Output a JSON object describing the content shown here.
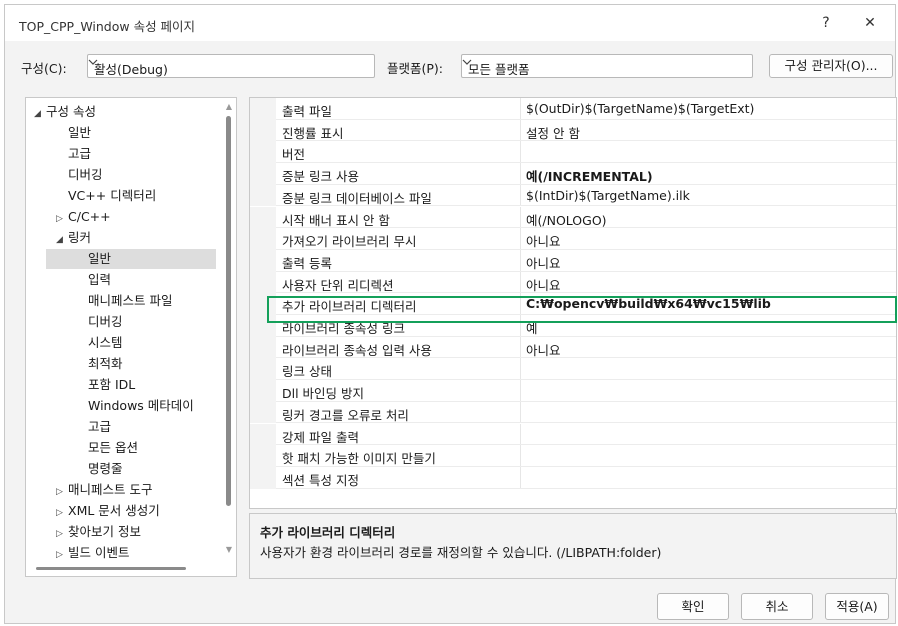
{
  "window": {
    "title": "TOP_CPP_Window 속성 페이지",
    "help": "?",
    "close": "✕"
  },
  "config": {
    "config_label": "구성(C):",
    "config_value": "활성(Debug)",
    "platform_label": "플랫폼(P):",
    "platform_value": "모든 플랫폼",
    "manager_button": "구성 관리자(O)..."
  },
  "tree": [
    {
      "label": "구성 속성",
      "arrow": "◢",
      "level": 0
    },
    {
      "label": "일반",
      "arrow": "",
      "level": 1
    },
    {
      "label": "고급",
      "arrow": "",
      "level": 1
    },
    {
      "label": "디버깅",
      "arrow": "",
      "level": 1
    },
    {
      "label": "VC++ 디렉터리",
      "arrow": "",
      "level": 1
    },
    {
      "label": "C/C++",
      "arrow": "▷",
      "level": 1
    },
    {
      "label": "링커",
      "arrow": "◢",
      "level": 1
    },
    {
      "label": "일반",
      "arrow": "",
      "level": 2,
      "selected": true
    },
    {
      "label": "입력",
      "arrow": "",
      "level": 2
    },
    {
      "label": "매니페스트 파일",
      "arrow": "",
      "level": 2
    },
    {
      "label": "디버깅",
      "arrow": "",
      "level": 2
    },
    {
      "label": "시스템",
      "arrow": "",
      "level": 2
    },
    {
      "label": "최적화",
      "arrow": "",
      "level": 2
    },
    {
      "label": "포함 IDL",
      "arrow": "",
      "level": 2
    },
    {
      "label": "Windows 메타데이",
      "arrow": "",
      "level": 2
    },
    {
      "label": "고급",
      "arrow": "",
      "level": 2
    },
    {
      "label": "모든 옵션",
      "arrow": "",
      "level": 2
    },
    {
      "label": "명령줄",
      "arrow": "",
      "level": 2
    },
    {
      "label": "매니페스트 도구",
      "arrow": "▷",
      "level": 1
    },
    {
      "label": "XML 문서 생성기",
      "arrow": "▷",
      "level": 1
    },
    {
      "label": "찾아보기 정보",
      "arrow": "▷",
      "level": 1
    },
    {
      "label": "빌드 이벤트",
      "arrow": "▷",
      "level": 1
    }
  ],
  "properties": [
    {
      "name": "출력 파일",
      "value": "$(OutDir)$(TargetName)$(TargetExt)",
      "bold": false
    },
    {
      "name": "진행률 표시",
      "value": "설정 안 함",
      "bold": false
    },
    {
      "name": "버전",
      "value": "",
      "bold": false
    },
    {
      "name": "증분 링크 사용",
      "value": "예(/INCREMENTAL)",
      "bold": true
    },
    {
      "name": "증분 링크 데이터베이스 파일",
      "value": "$(IntDir)$(TargetName).ilk",
      "bold": false
    },
    {
      "name": "시작 배너 표시 안 함",
      "value": "예(/NOLOGO)",
      "bold": false
    },
    {
      "name": "가져오기 라이브러리 무시",
      "value": "아니요",
      "bold": false
    },
    {
      "name": "출력 등록",
      "value": "아니요",
      "bold": false
    },
    {
      "name": "사용자 단위 리디렉션",
      "value": "아니요",
      "bold": false
    },
    {
      "name": "추가 라이브러리 디렉터리",
      "value": "C:₩opencv₩build₩x64₩vc15₩lib",
      "bold": true
    },
    {
      "name": "라이브러리 종속성 링크",
      "value": "예",
      "bold": false
    },
    {
      "name": "라이브러리 종속성 입력 사용",
      "value": "아니요",
      "bold": false
    },
    {
      "name": "링크 상태",
      "value": "",
      "bold": false
    },
    {
      "name": "Dll 바인딩 방지",
      "value": "",
      "bold": false
    },
    {
      "name": "링커 경고를 오류로 처리",
      "value": "",
      "bold": false
    },
    {
      "name": "강제 파일 출력",
      "value": "",
      "bold": false
    },
    {
      "name": "핫 패치 가능한 이미지 만들기",
      "value": "",
      "bold": false
    },
    {
      "name": "섹션 특성 지정",
      "value": "",
      "bold": false
    }
  ],
  "description": {
    "title": "추가 라이브러리 디렉터리",
    "text": "사용자가 환경 라이브러리 경로를 재정의할 수 있습니다. (/LIBPATH:folder)"
  },
  "buttons": {
    "ok": "확인",
    "cancel": "취소",
    "apply": "적용(A)"
  },
  "colors": {
    "highlight_border": "#14a05a",
    "selected_bg": "#dddddd"
  }
}
